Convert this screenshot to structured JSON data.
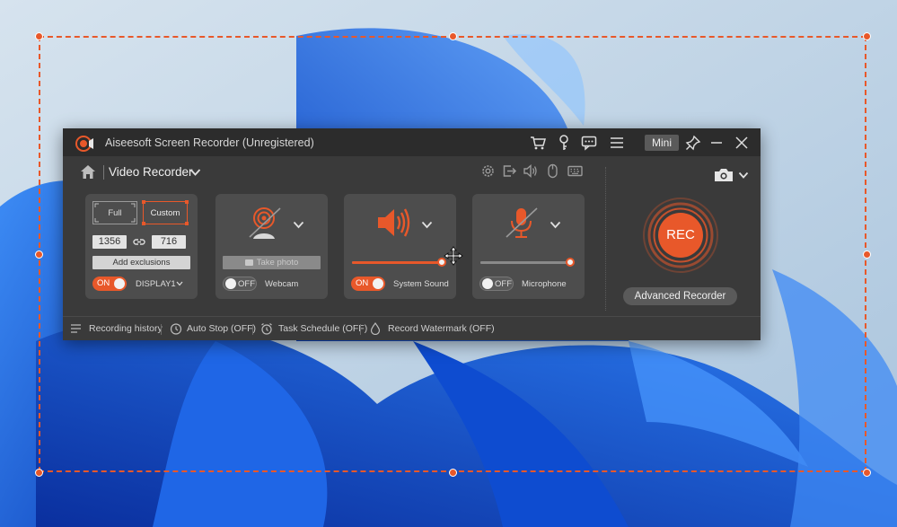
{
  "window": {
    "title": "Aiseesoft Screen Recorder (Unregistered)",
    "mini_label": "Mini",
    "titlebar_icons": [
      "cart-icon",
      "key-icon",
      "chat-icon",
      "menu-icon"
    ],
    "window_controls": [
      "pin-icon",
      "minimize-icon",
      "close-icon"
    ]
  },
  "mode": {
    "label": "Video Recorder",
    "toolbar_icons": [
      "gear-icon",
      "export-icon",
      "speaker-icon",
      "mouse-icon",
      "keyboard-icon"
    ]
  },
  "area": {
    "full_label": "Full",
    "custom_label": "Custom",
    "width": "1356",
    "height": "716",
    "exclusions_label": "Add exclusions",
    "toggle_label": "ON",
    "display_label": "DISPLAY1"
  },
  "webcam": {
    "photo_label": "Take photo",
    "toggle_label": "OFF",
    "label": "Webcam"
  },
  "system_sound": {
    "toggle_label": "ON",
    "label": "System Sound",
    "volume": 1.0
  },
  "microphone": {
    "toggle_label": "OFF",
    "label": "Microphone",
    "volume": 1.0
  },
  "record": {
    "rec_label": "REC",
    "advanced_label": "Advanced Recorder"
  },
  "bottom": {
    "history_label": "Recording history",
    "autostop_label": "Auto Stop (OFF)",
    "schedule_label": "Task Schedule (OFF)",
    "watermark_label": "Record Watermark (OFF)"
  },
  "colors": {
    "accent": "#e8582a",
    "window_bg": "#3a3a3a",
    "titlebar_bg": "#2c2c2c",
    "panel_bg": "#4d4d4d"
  }
}
